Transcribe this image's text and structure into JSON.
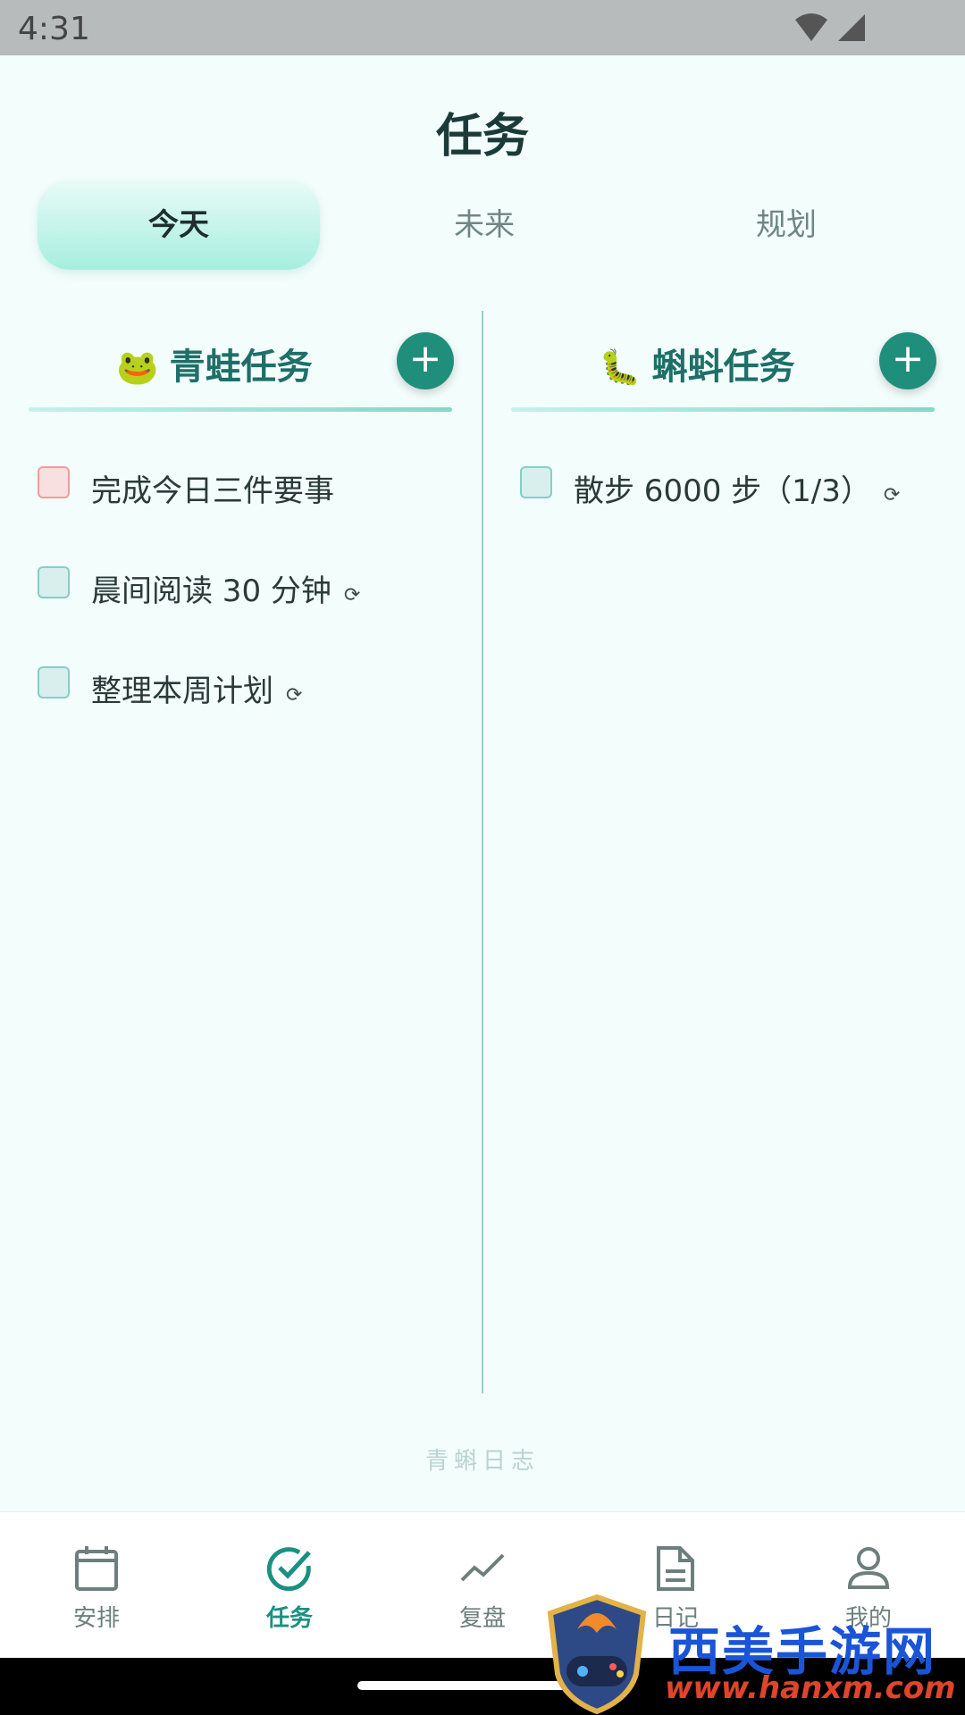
{
  "status_bar": {
    "time": "4:31"
  },
  "header": {
    "title": "任务"
  },
  "tabs": [
    {
      "label": "今天",
      "active": true
    },
    {
      "label": "未来",
      "active": false
    },
    {
      "label": "规划",
      "active": false
    }
  ],
  "columns": {
    "frog": {
      "emoji": "🐸",
      "title": "青蛙任务",
      "add_label": "+",
      "tasks": [
        {
          "text": "完成今日三件要事",
          "repeat": "",
          "checked": false,
          "priority": "high"
        },
        {
          "text": "晨间阅读 30 分钟",
          "repeat": "⟳",
          "checked": false
        },
        {
          "text": "整理本周计划",
          "repeat": "⟳",
          "checked": false
        }
      ]
    },
    "tadpole": {
      "emoji": "🐛",
      "title": "蝌蚪任务",
      "add_label": "+",
      "tasks": [
        {
          "text": "散步 6000 步（1/3）",
          "repeat": "⟳",
          "checked": false
        }
      ]
    }
  },
  "footer_brand": "青蝌日志",
  "nav": [
    {
      "label": "安排",
      "icon": "calendar-icon",
      "active": false
    },
    {
      "label": "任务",
      "icon": "check-circle-icon",
      "active": true
    },
    {
      "label": "复盘",
      "icon": "trend-line-icon",
      "active": false
    },
    {
      "label": "日记",
      "icon": "document-icon",
      "active": false
    },
    {
      "label": "我的",
      "icon": "person-icon",
      "active": false
    }
  ],
  "watermark": {
    "text": "西美手游网",
    "url": "www.hanxm.com"
  },
  "colors": {
    "accent": "#1f8f7c",
    "nav_active": "#1a9082",
    "background": "#f3fdfc",
    "high_priority_border": "#f09d9d"
  }
}
